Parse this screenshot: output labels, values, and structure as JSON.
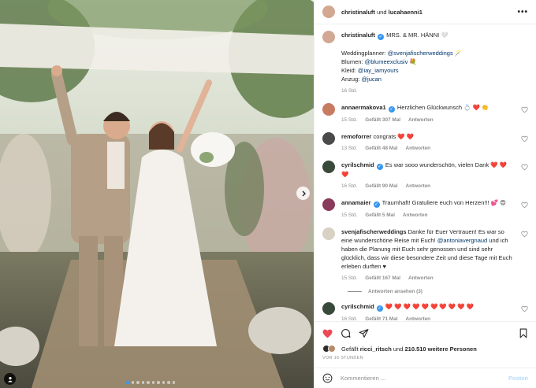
{
  "header": {
    "user1": "christinaluft",
    "conjunction": "und",
    "user2": "lucahaenni1"
  },
  "caption": {
    "user": "christinaluft",
    "title": "MRS. & MR. HÄNNI 🤍",
    "lines": [
      {
        "label": "Weddingplanner: ",
        "mention": "@svenjafischerweddings",
        "emoji": " 🪄"
      },
      {
        "label": "Blumen: ",
        "mention": "@blumeexclusiv",
        "emoji": " 💐"
      },
      {
        "label": "Kleid: ",
        "mention": "@iay_iamyours",
        "emoji": ""
      },
      {
        "label": "Anzug: ",
        "mention": "@jucan",
        "emoji": ""
      }
    ],
    "age": "16 Std."
  },
  "comments": [
    {
      "user": "annaermakova1",
      "verified": true,
      "text": "Herzlichen Glückwunsch 💍 ❤️ 👏",
      "age": "15 Std.",
      "likes": "Gefällt 307 Mal",
      "reply": "Antworten",
      "avatar_color": "#c77c62"
    },
    {
      "user": "remoforrer",
      "verified": false,
      "text": "congrats ❤️ ❤️",
      "age": "13 Std.",
      "likes": "Gefällt 48 Mal",
      "reply": "Antworten",
      "avatar_color": "#4a4a4a"
    },
    {
      "user": "cyrilschmid",
      "verified": true,
      "text": "Es war sooo wunderschön, vielen Dank ❤️ ❤️ ❤️",
      "age": "16 Std.",
      "likes": "Gefällt 90 Mal",
      "reply": "Antworten",
      "avatar_color": "#3a4a3a"
    },
    {
      "user": "annamaier",
      "verified": true,
      "text": "Traumhaft! Gratuliere euch von Herzen!!! 💕 😍",
      "age": "15 Std.",
      "likes": "Gefällt 5 Mal",
      "reply": "Antworten",
      "avatar_color": "#8a3a5a"
    },
    {
      "user": "svenjafischerweddings",
      "verified": false,
      "text_before": "Danke für Euer Vertrauen! Es war so eine wunderschöne Reise mit Euch! ",
      "mention": "@antoniavergnaud",
      "text_after": " und ich haben die Planung mit Euch sehr genossen und sind sehr glücklich, dass wir diese besondere Zeit und diese Tage mit Euch erleben durften ♥",
      "age": "15 Std.",
      "likes": "Gefällt 167 Mal",
      "reply": "Antworten",
      "avatar_color": "#d8d2c4"
    },
    {
      "user": "cyrilschmid",
      "verified": true,
      "text": "❤️ ❤️ ❤️ ❤️ ❤️ ❤️ ❤️ ❤️ ❤️ ❤️",
      "age": "16 Std.",
      "likes": "Gefällt 71 Mal",
      "reply": "Antworten",
      "avatar_color": "#3a4a3a"
    }
  ],
  "view_replies": "Antworten ansehen (3)",
  "likes_line": {
    "prefix": "Gefällt ",
    "user": "ricci_ritsch",
    "middle": " und ",
    "count": "210.510 weitere Personen"
  },
  "timestamp": "VOR 16 STUNDEN",
  "add_comment": {
    "placeholder": "Kommentieren ...",
    "post_label": "Posten"
  },
  "colors": {
    "accent": "#3897f0",
    "like_red": "#ed4956",
    "muted": "#8e8e8e"
  },
  "carousel": {
    "count": 10,
    "active": 1
  }
}
